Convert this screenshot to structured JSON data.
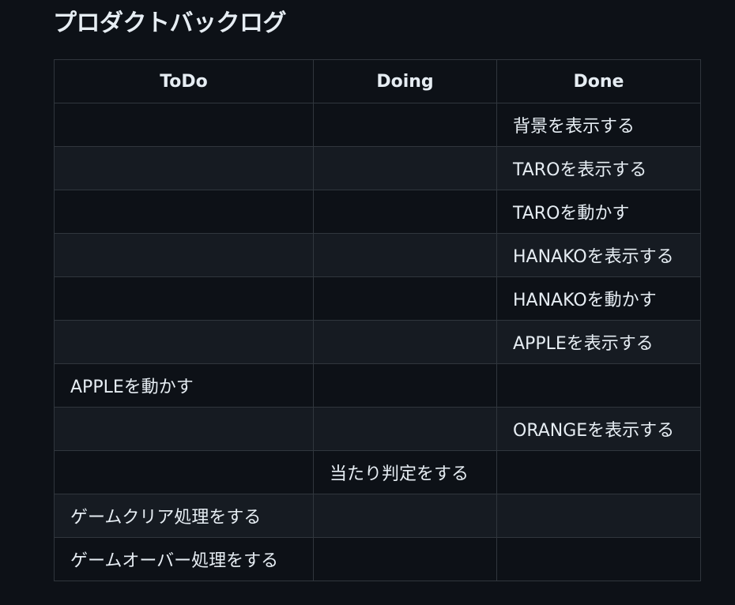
{
  "page": {
    "title": "プロダクトバックログ"
  },
  "table": {
    "headers": {
      "todo": "ToDo",
      "doing": "Doing",
      "done": "Done"
    }
  },
  "rows": [
    {
      "todo": "",
      "doing": "",
      "done": "背景を表示する"
    },
    {
      "todo": "",
      "doing": "",
      "done": "TAROを表示する"
    },
    {
      "todo": "",
      "doing": "",
      "done": "TAROを動かす"
    },
    {
      "todo": "",
      "doing": "",
      "done": "HANAKOを表示する"
    },
    {
      "todo": "",
      "doing": "",
      "done": "HANAKOを動かす"
    },
    {
      "todo": "",
      "doing": "",
      "done": "APPLEを表示する"
    },
    {
      "todo": "APPLEを動かす",
      "doing": "",
      "done": ""
    },
    {
      "todo": "",
      "doing": "",
      "done": "ORANGEを表示する"
    },
    {
      "todo": "",
      "doing": "当たり判定をする",
      "done": ""
    },
    {
      "todo": "ゲームクリア処理をする",
      "doing": "",
      "done": ""
    },
    {
      "todo": "ゲームオーバー処理をする",
      "doing": "",
      "done": ""
    }
  ]
}
